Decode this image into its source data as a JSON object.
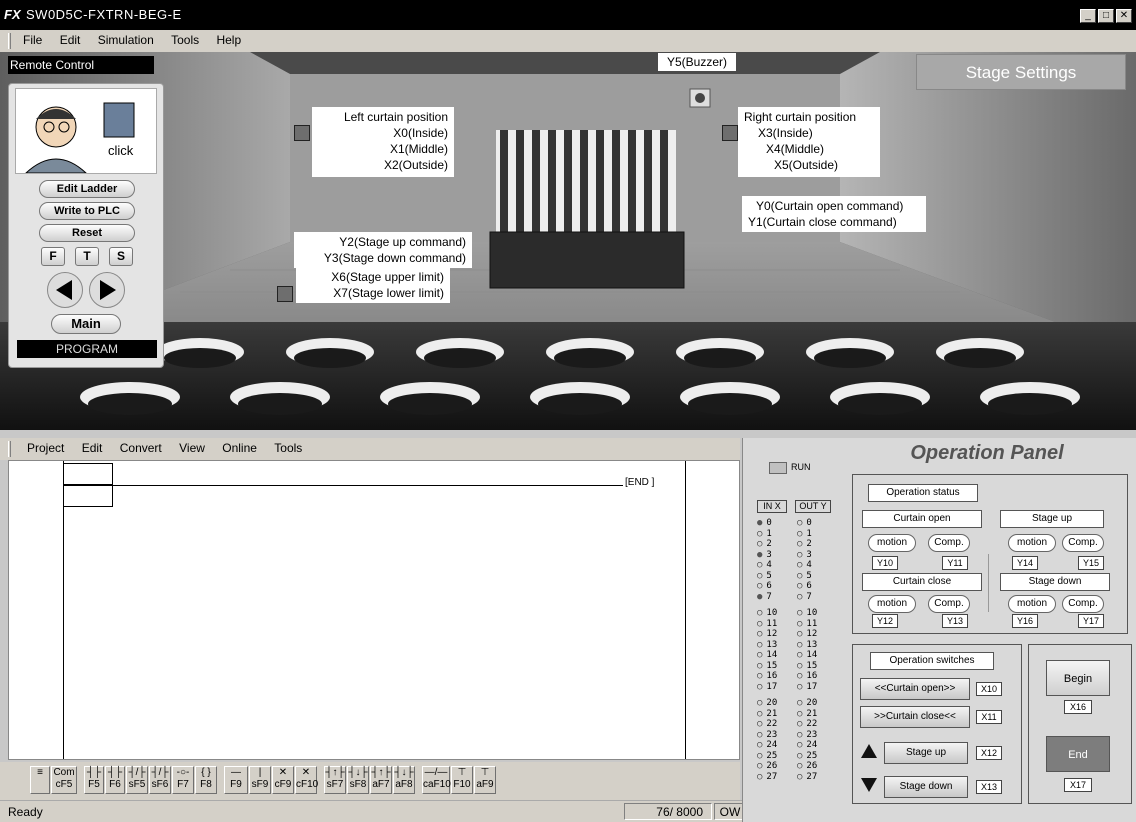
{
  "app": {
    "title": "SW0D5C-FXTRN-BEG-E",
    "logo": "FX"
  },
  "window_controls": {
    "minimize": "_",
    "maximize": "□",
    "close": "✕"
  },
  "menu": [
    "File",
    "Edit",
    "Simulation",
    "Tools",
    "Help"
  ],
  "scene": {
    "remote_label": "Remote Control",
    "buzzer": "Y5(Buzzer)",
    "stage_settings": "Stage Settings",
    "left_curtain": [
      "Left curtain position",
      "X0(Inside)",
      "X1(Middle)",
      "X2(Outside)"
    ],
    "right_curtain": [
      "Right curtain position",
      "X3(Inside)",
      "X4(Middle)",
      "X5(Outside)"
    ],
    "curtain_cmd": [
      "Y0(Curtain open command)",
      "Y1(Curtain close command)"
    ],
    "stage_cmd": [
      "Y2(Stage up command)",
      "Y3(Stage down command)"
    ],
    "stage_limit": [
      "X6(Stage upper limit)",
      "X7(Stage lower limit)"
    ]
  },
  "remote": {
    "click": "click",
    "edit_ladder": "Edit Ladder",
    "write_plc": "Write to PLC",
    "reset": "Reset",
    "f": "F",
    "t": "T",
    "s": "S",
    "main": "Main",
    "mode": "PROGRAM"
  },
  "ladder_menu": [
    "Project",
    "Edit",
    "Convert",
    "View",
    "Online",
    "Tools"
  ],
  "ladder": {
    "end": "[END ]"
  },
  "toolbar": [
    {
      "top": "≡",
      "bot": ""
    },
    {
      "top": "Com",
      "bot": "cF5"
    },
    {
      "top": "┤├",
      "bot": "F5"
    },
    {
      "top": "┤├",
      "bot": "F6"
    },
    {
      "top": "┤/├",
      "bot": "sF5"
    },
    {
      "top": "┤/├",
      "bot": "sF6"
    },
    {
      "top": "-○-",
      "bot": "F7"
    },
    {
      "top": "{ }",
      "bot": "F8"
    },
    {
      "top": "—",
      "bot": "F9"
    },
    {
      "top": "|",
      "bot": "sF9"
    },
    {
      "top": "✕",
      "bot": "cF9"
    },
    {
      "top": "✕",
      "bot": "cF10"
    },
    {
      "top": "┤↑├",
      "bot": "sF7"
    },
    {
      "top": "┤↓├",
      "bot": "sF8"
    },
    {
      "top": "┤↑├",
      "bot": "aF7"
    },
    {
      "top": "┤↓├",
      "bot": "aF8"
    },
    {
      "top": "—/—",
      "bot": "caF10"
    },
    {
      "top": "⊤",
      "bot": "F10"
    },
    {
      "top": "⊤",
      "bot": "aF9"
    }
  ],
  "status": {
    "ready": "Ready",
    "steps": "76/ 8000",
    "mode": "OW"
  },
  "io_panel": {
    "run": "RUN",
    "in_header": "IN X",
    "out_header": "OUT Y",
    "group1": [
      "0",
      "1",
      "2",
      "3",
      "4",
      "5",
      "6",
      "7"
    ],
    "group2": [
      "10",
      "11",
      "12",
      "13",
      "14",
      "15",
      "16",
      "17"
    ],
    "group3": [
      "20",
      "21",
      "22",
      "23",
      "24",
      "25",
      "26",
      "27"
    ],
    "in_active": [
      "0",
      "3",
      "7"
    ]
  },
  "op_panel": {
    "title": "Operation Panel",
    "status_title": "Operation status",
    "curtain_open": "Curtain open",
    "curtain_close": "Curtain close",
    "stage_up": "Stage up",
    "stage_down": "Stage down",
    "motion": "motion",
    "comp": "Comp.",
    "y10": "Y10",
    "y11": "Y11",
    "y12": "Y12",
    "y13": "Y13",
    "y14": "Y14",
    "y15": "Y15",
    "y16": "Y16",
    "y17": "Y17",
    "switches_title": "Operation switches",
    "sw_open": "<<Curtain open>>",
    "sw_close": ">>Curtain close<<",
    "sw_up": "Stage up",
    "sw_down": "Stage down",
    "x10": "X10",
    "x11": "X11",
    "x12": "X12",
    "x13": "X13",
    "begin": "Begin",
    "x16": "X16",
    "end": "End",
    "x17": "X17"
  },
  "colors": {
    "end_button": "#7d7d7d",
    "active_led": "#555555"
  }
}
